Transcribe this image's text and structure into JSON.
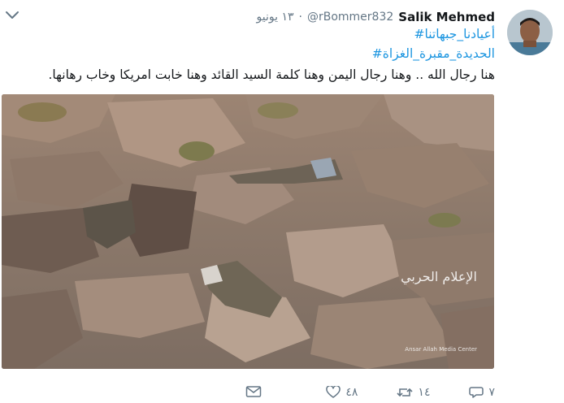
{
  "tweet": {
    "display_name": "Salik Mehmed",
    "handle": "@rBommer832",
    "dot": "·",
    "date": "١٣ يونيو",
    "hashtags": [
      "#أعيادنا_جبهاتنا",
      "#الحديدة_مقبرة_الغزاة"
    ],
    "text": "هنا رجال الله .. وهنا رجال اليمن وهنا كلمة السيد القائد وهنا خابت امريكا وخاب رهانها."
  },
  "media": {
    "watermark": "الإعلام الحربي",
    "logo_text": "Ansar Allah Media Center"
  },
  "actions": {
    "reply_count": "٧",
    "retweet_count": "١٤",
    "like_count": "٤٨"
  },
  "colors": {
    "link": "#1b95e0",
    "text": "#14171a",
    "muted": "#657786"
  },
  "icons": {
    "menu": "chevron-down-icon",
    "reply": "reply-icon",
    "retweet": "retweet-icon",
    "like": "heart-icon",
    "dm": "envelope-icon"
  }
}
